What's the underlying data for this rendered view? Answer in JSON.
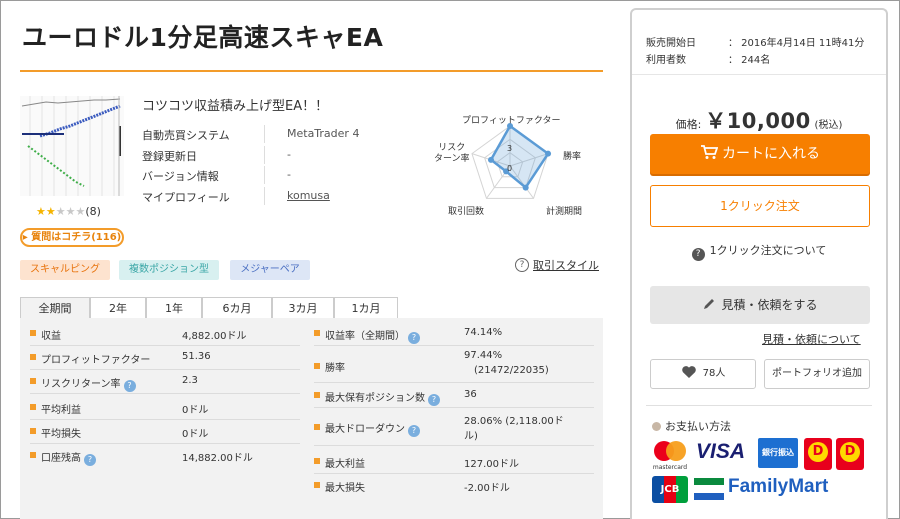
{
  "product": {
    "title": "ユーロドル1分足高速スキャEA",
    "catch_copy": "コツコツ収益積み上げ型EA！！",
    "rating_count": "(8)",
    "review_link": "▸ 質問はコチラ(116)",
    "info": [
      {
        "label": "自動売買システム",
        "value": "MetaTrader 4"
      },
      {
        "label": "登録更新日",
        "value": "-"
      },
      {
        "label": "バージョン情報",
        "value": "-"
      },
      {
        "label": "マイプロフィール",
        "value": "komusa"
      }
    ],
    "tags": [
      "スキャルピング",
      "複数ポジション型",
      "メジャーペア"
    ],
    "trade_style_link": "取引スタイル"
  },
  "radar": {
    "labels": [
      "プロフィットファクター",
      "勝率",
      "計測期間",
      "取引回数",
      "リスク\nターン率"
    ],
    "scale_labels": [
      "3",
      "0"
    ],
    "values": [
      3,
      3,
      2,
      0.5,
      1.5
    ],
    "max": 3,
    "color": "#5b9bd5"
  },
  "tabs": [
    "全期間",
    "2年",
    "1年",
    "6カ月",
    "3カ月",
    "1カ月"
  ],
  "active_tab": 0,
  "stats_left": [
    {
      "label": "収益",
      "value": "4,882.00ドル",
      "help": false
    },
    {
      "label": "プロフィットファクター",
      "value": "51.36",
      "help": false
    },
    {
      "label": "リスクリターン率",
      "value": "2.3",
      "help": true
    },
    {
      "label": "平均利益",
      "value": "0ドル",
      "help": false
    },
    {
      "label": "平均損失",
      "value": "0ドル",
      "help": false
    },
    {
      "label": "口座残高",
      "value": "14,882.00ドル",
      "help": true
    }
  ],
  "stats_right": [
    {
      "label": "収益率（全期間）",
      "value": "74.14%",
      "value2": "",
      "help": true
    },
    {
      "label": "勝率",
      "value": "97.44%",
      "value2": "(21472/22035)",
      "help": false
    },
    {
      "label": "最大保有ポジション数",
      "value": "36",
      "value2": "",
      "help": true
    },
    {
      "label": "最大ドローダウン",
      "value": "28.06% (2,118.00ド",
      "value2": "ル)",
      "help": true
    },
    {
      "label": "最大利益",
      "value": "127.00ドル",
      "value2": "",
      "help": false
    },
    {
      "label": "最大損失",
      "value": "-2.00ドル",
      "value2": "",
      "help": false
    }
  ],
  "sidebar": {
    "meta": [
      {
        "label": "販売開始日",
        "value": "： 2016年4月14日 11時41分"
      },
      {
        "label": "利用者数",
        "value": "： 244名"
      }
    ],
    "price_label": "価格:",
    "price_value": "￥10,000",
    "price_tax": "(税込)",
    "cart_button": "カートに入れる",
    "one_click_button": "1クリック注文",
    "one_click_about": "1クリック注文について",
    "quote_button": "見積・依頼をする",
    "quote_about": "見積・依頼について",
    "favorite_count": "78人",
    "portfolio_button": "ポートフォリオ追加",
    "payment_title": "お支払い方法",
    "payment_logos": {
      "mastercard": "mastercard",
      "visa": "VISA",
      "bank": "銀行振込",
      "daily1": "D",
      "daily2": "D",
      "jcb": "JCB",
      "familymart": "FamilyMart"
    },
    "accent_color": "#f77f00"
  }
}
